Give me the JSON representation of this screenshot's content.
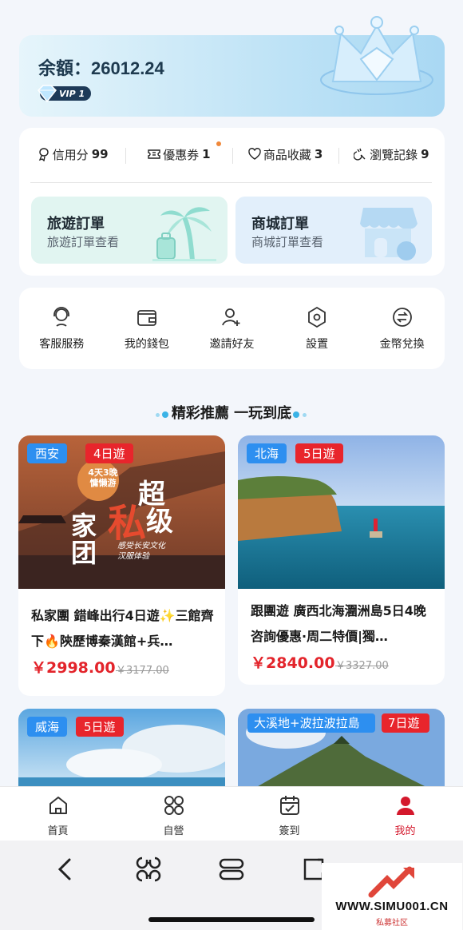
{
  "balance": {
    "label": "余額：",
    "amount": "26012.24",
    "vip": "VIP 1"
  },
  "stats": [
    {
      "label": "信用分",
      "value": "99",
      "icon": "credit-icon"
    },
    {
      "label": "優惠券",
      "value": "1",
      "icon": "coupon-icon"
    },
    {
      "label": "商品收藏",
      "value": "3",
      "icon": "heart-icon"
    },
    {
      "label": "瀏覽記錄",
      "value": "9",
      "icon": "history-icon"
    }
  ],
  "orders": {
    "travel": {
      "title": "旅遊訂單",
      "subtitle": "旅遊訂單查看"
    },
    "mall": {
      "title": "商城訂單",
      "subtitle": "商城訂單查看"
    }
  },
  "services": [
    {
      "label": "客服服務",
      "icon": "customer-service-icon"
    },
    {
      "label": "我的錢包",
      "icon": "wallet-icon"
    },
    {
      "label": "邀請好友",
      "icon": "add-friend-icon"
    },
    {
      "label": "設置",
      "icon": "settings-icon"
    },
    {
      "label": "金幣兌換",
      "icon": "exchange-icon"
    }
  ],
  "section": {
    "title": "精彩推薦 一玩到底"
  },
  "products": [
    {
      "location": "西安",
      "days": "4日遊",
      "title": "私家團 錯峰出行4日遊✨三館齊下🔥陝歷博秦漢館+兵…",
      "price": "￥2998.00",
      "old_price": "￥3177.00",
      "poster": {
        "badge1": "4天3晚",
        "badge2": "慵懒游",
        "line1": "超",
        "line2": "私",
        "line3": "级",
        "line4": "家",
        "line5": "团",
        "caption1": "感受长安文化",
        "caption2": "汉服体验"
      }
    },
    {
      "location": "北海",
      "days": "5日遊",
      "title": "跟團遊 廣西北海潿洲島5日4晚 咨詢優惠·周二特價|獨…",
      "price": "￥2840.00",
      "old_price": "￥3327.00"
    },
    {
      "location": "威海",
      "days": "5日遊"
    },
    {
      "location": "大溪地+波拉波拉島",
      "days": "7日遊"
    }
  ],
  "bottom_nav": [
    {
      "label": "首頁",
      "icon": "home-icon"
    },
    {
      "label": "自營",
      "icon": "grid-icon"
    },
    {
      "label": "簽到",
      "icon": "calendar-check-icon"
    },
    {
      "label": "我的",
      "icon": "user-icon",
      "active": true
    }
  ],
  "watermark": {
    "url": "WWW.SIMU001.CN",
    "sub": "私募社区"
  },
  "colors": {
    "accent_red": "#e3242b",
    "tag_blue": "#2d8ff0",
    "active_nav": "#d4182c"
  }
}
